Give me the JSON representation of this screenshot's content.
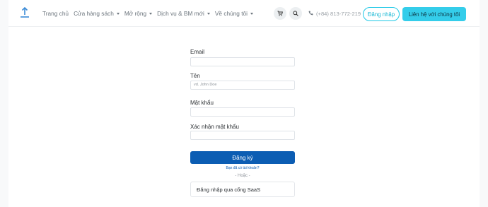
{
  "header": {
    "nav": [
      {
        "label": "Trang chủ",
        "dropdown": false
      },
      {
        "label": "Cửa hàng sách",
        "dropdown": true
      },
      {
        "label": "Mở rộng",
        "dropdown": true
      },
      {
        "label": "Dịch vụ & BM mới",
        "dropdown": true
      },
      {
        "label": "Về chúng tôi",
        "dropdown": true
      }
    ],
    "phone": "(+84) 813-772-219",
    "login_label": "Đăng nhập",
    "contact_label": "Liên hệ với chúng tôi"
  },
  "form": {
    "email_label": "Email",
    "email_value": "",
    "name_label": "Tên",
    "name_placeholder": "vd. John Doe",
    "password_label": "Mật khẩu",
    "password_value": "",
    "confirm_label": "Xác nhận mật khẩu",
    "confirm_value": "",
    "register_label": "Đăng ký",
    "have_account": "Bạn đã có tài khoản?",
    "or_text": "- Hoặc -",
    "saas_label": "Đăng nhập qua cổng SaaS"
  },
  "colors": {
    "accent": "#34cdea",
    "primary": "#0c5db3",
    "login_border": "#1ec8e6"
  },
  "icons": [
    "logo-icon",
    "cart-icon",
    "search-icon",
    "phone-icon",
    "caret-down-icon"
  ]
}
